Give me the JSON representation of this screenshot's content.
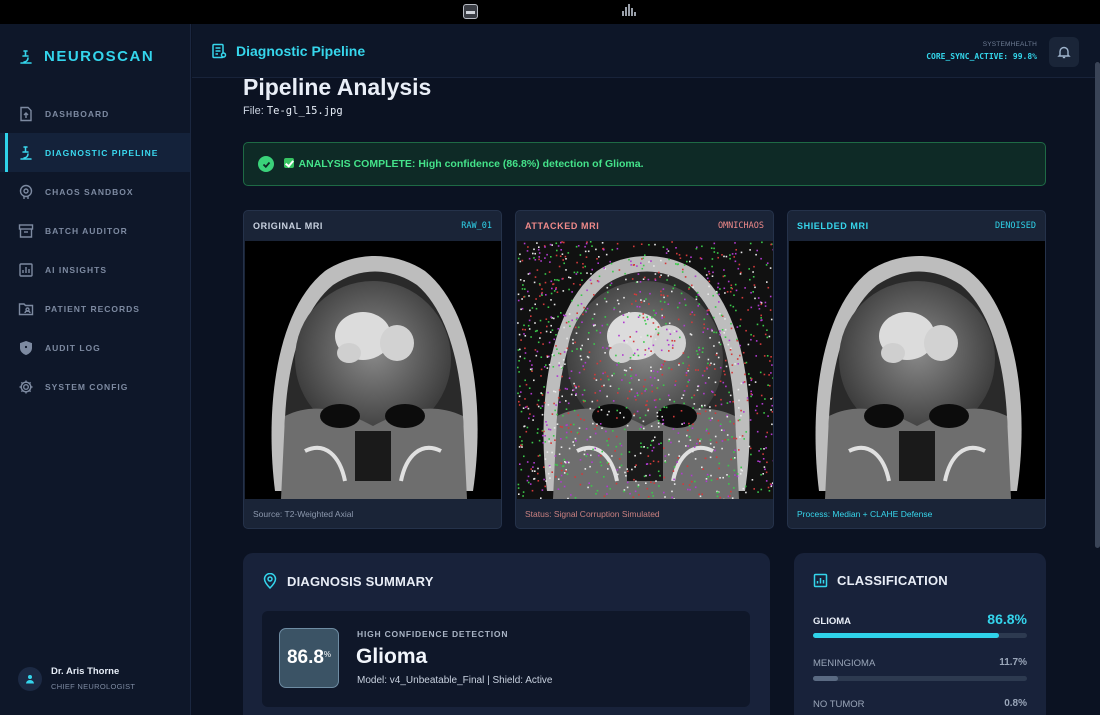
{
  "app": {
    "name": "NEUROSCAN"
  },
  "sidebar": {
    "items": [
      {
        "label": "DASHBOARD",
        "icon": "file-upload-icon"
      },
      {
        "label": "DIAGNOSTIC PIPELINE",
        "icon": "microscope-icon",
        "active": true
      },
      {
        "label": "CHAOS SANDBOX",
        "icon": "brain-bug-icon"
      },
      {
        "label": "BATCH AUDITOR",
        "icon": "archive-icon"
      },
      {
        "label": "AI INSIGHTS",
        "icon": "bar-chart-icon"
      },
      {
        "label": "PATIENT RECORDS",
        "icon": "folder-user-icon"
      },
      {
        "label": "AUDIT LOG",
        "icon": "shield-icon"
      },
      {
        "label": "SYSTEM CONFIG",
        "icon": "gear-icon"
      }
    ]
  },
  "user": {
    "name": "Dr. Aris Thorne",
    "role": "CHIEF NEUROLOGIST"
  },
  "header": {
    "title": "Diagnostic Pipeline",
    "system_health_label": "SYSTEMHEALTH",
    "system_health_value": "CORE_SYNC_ACTIVE: 99.8%"
  },
  "main": {
    "title": "Pipeline Analysis",
    "file_label": "File:",
    "file_name": "Te-gl_15.jpg",
    "alert": {
      "text": "ANALYSIS COMPLETE: High confidence (86.8%) detection of Glioma.",
      "color": "#44e38a"
    },
    "images": [
      {
        "title": "ORIGINAL MRI",
        "tag": "RAW_01",
        "footer": "Source: T2-Weighted Axial",
        "tag_color": "#2fd3ea",
        "title_color": "#c9d2e0",
        "footer_color": "#8d99ae"
      },
      {
        "title": "ATTACKED MRI",
        "tag": "OMNICHAOS",
        "footer": "Status: Signal Corruption Simulated",
        "tag_color": "#f08a8a",
        "title_color": "#f08a8a",
        "footer_color": "#c98080"
      },
      {
        "title": "SHIELDED MRI",
        "tag": "DENOISED",
        "footer": "Process: Median + CLAHE Defense",
        "tag_color": "#2fd3ea",
        "title_color": "#37d6ec",
        "footer_color": "#37d6ec"
      }
    ],
    "diagnosis": {
      "heading": "DIAGNOSIS SUMMARY",
      "score": "86.8",
      "score_unit": "%",
      "label": "HIGH CONFIDENCE DETECTION",
      "diagnosis": "Glioma",
      "model_line": "Model: v4_Unbeatable_Final | Shield: Active"
    },
    "classification": {
      "heading": "CLASSIFICATION",
      "items": [
        {
          "name": "GLIOMA",
          "percent": "86.8%",
          "value": 0.868,
          "color": "#2fd3ea"
        },
        {
          "name": "MENINGIOMA",
          "percent": "11.7%",
          "value": 0.117,
          "color": "#5a6a82"
        },
        {
          "name": "NO TUMOR",
          "percent": "0.8%",
          "value": 0.008,
          "color": "#5a6a82"
        }
      ]
    }
  }
}
